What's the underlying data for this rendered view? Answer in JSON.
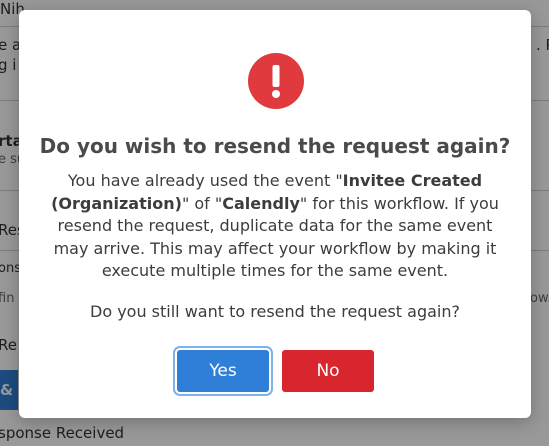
{
  "background": {
    "fragments": [
      "Nih",
      "e a",
      "g i",
      ". Pl",
      "rta",
      "e su",
      "Res",
      "onse",
      "fin",
      "ow.",
      "Re",
      "& S",
      "sponse Received"
    ]
  },
  "dialog": {
    "title": "Do you wish to resend the request again?",
    "body_prefix": "You have already used the event \"",
    "event_name": "Invitee Created (Organization)",
    "body_middle": "\" of \"",
    "app_name": "Calendly",
    "body_suffix": "\" for this workflow. If you resend the request, duplicate data for the same event may arrive. This may affect your workflow by making it execute multiple times for the same event.",
    "question": "Do you still want to resend the request again?",
    "yes_label": "Yes",
    "no_label": "No"
  },
  "colors": {
    "alert_icon": "#e03a3e",
    "yes_button": "#2f7fd8",
    "no_button": "#d9262e"
  },
  "icons": {
    "alert": "exclamation-circle-icon"
  }
}
